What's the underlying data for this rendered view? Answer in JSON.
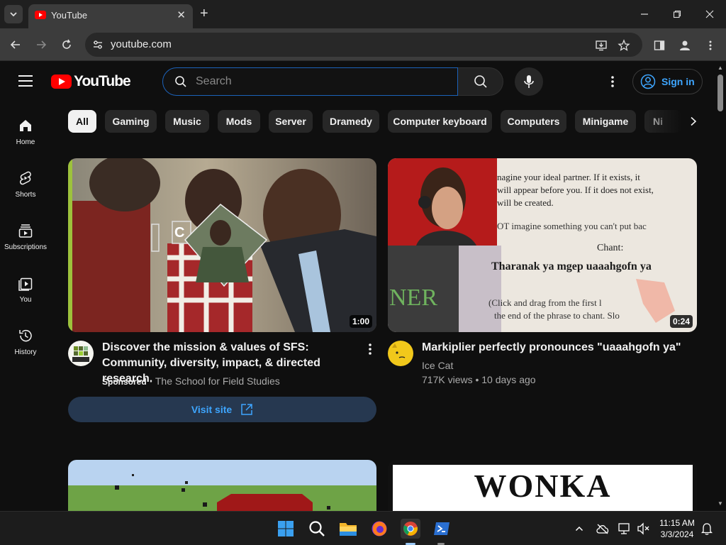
{
  "browser": {
    "tab_title": "YouTube",
    "new_tab": "+",
    "url": "youtube.com"
  },
  "header": {
    "logo_text": "YouTube",
    "search_placeholder": "Search",
    "signin_label": "Sign in"
  },
  "sidebar": {
    "items": [
      {
        "label": "Home",
        "icon": "home-icon"
      },
      {
        "label": "Shorts",
        "icon": "shorts-icon"
      },
      {
        "label": "Subscriptions",
        "icon": "subscriptions-icon"
      },
      {
        "label": "You",
        "icon": "you-icon"
      },
      {
        "label": "History",
        "icon": "history-icon"
      }
    ]
  },
  "chips": [
    "All",
    "Gaming",
    "Music",
    "Mods",
    "Server",
    "Dramedy",
    "Computer keyboard",
    "Computers",
    "Minigame",
    "Ni"
  ],
  "videos": [
    {
      "title": "Discover the mission & values of SFS: Community, diversity, impact, & directed research.",
      "duration": "1:00",
      "sponsored_label": "Sponsored",
      "channel": "The School for Field Studies",
      "cta": "Visit site",
      "thumb_text": "C"
    },
    {
      "title": "Markiplier perfectly pronounces \"uaaahgofn ya\"",
      "duration": "0:24",
      "channel": "Ice Cat",
      "stats": "717K views • 10 days ago",
      "thumb_lines": [
        "nagine your ideal partner.  If it exists, it",
        "will appear before you.  If it does not exist,",
        "will be created.",
        "OT imagine something you can't put bac",
        "Chant:",
        "Tharanak ya mgep uaaahgofn ya",
        "(Click and drag from the first l",
        "the end of the phrase to chant. Slo",
        "NER"
      ]
    },
    {
      "thumb_text": "WONKA"
    }
  ],
  "taskbar": {
    "time": "11:15 AM",
    "date": "3/3/2024"
  },
  "colors": {
    "brand_red": "#ff0000",
    "link_blue": "#3ea6ff",
    "background": "#0f0f0f"
  }
}
